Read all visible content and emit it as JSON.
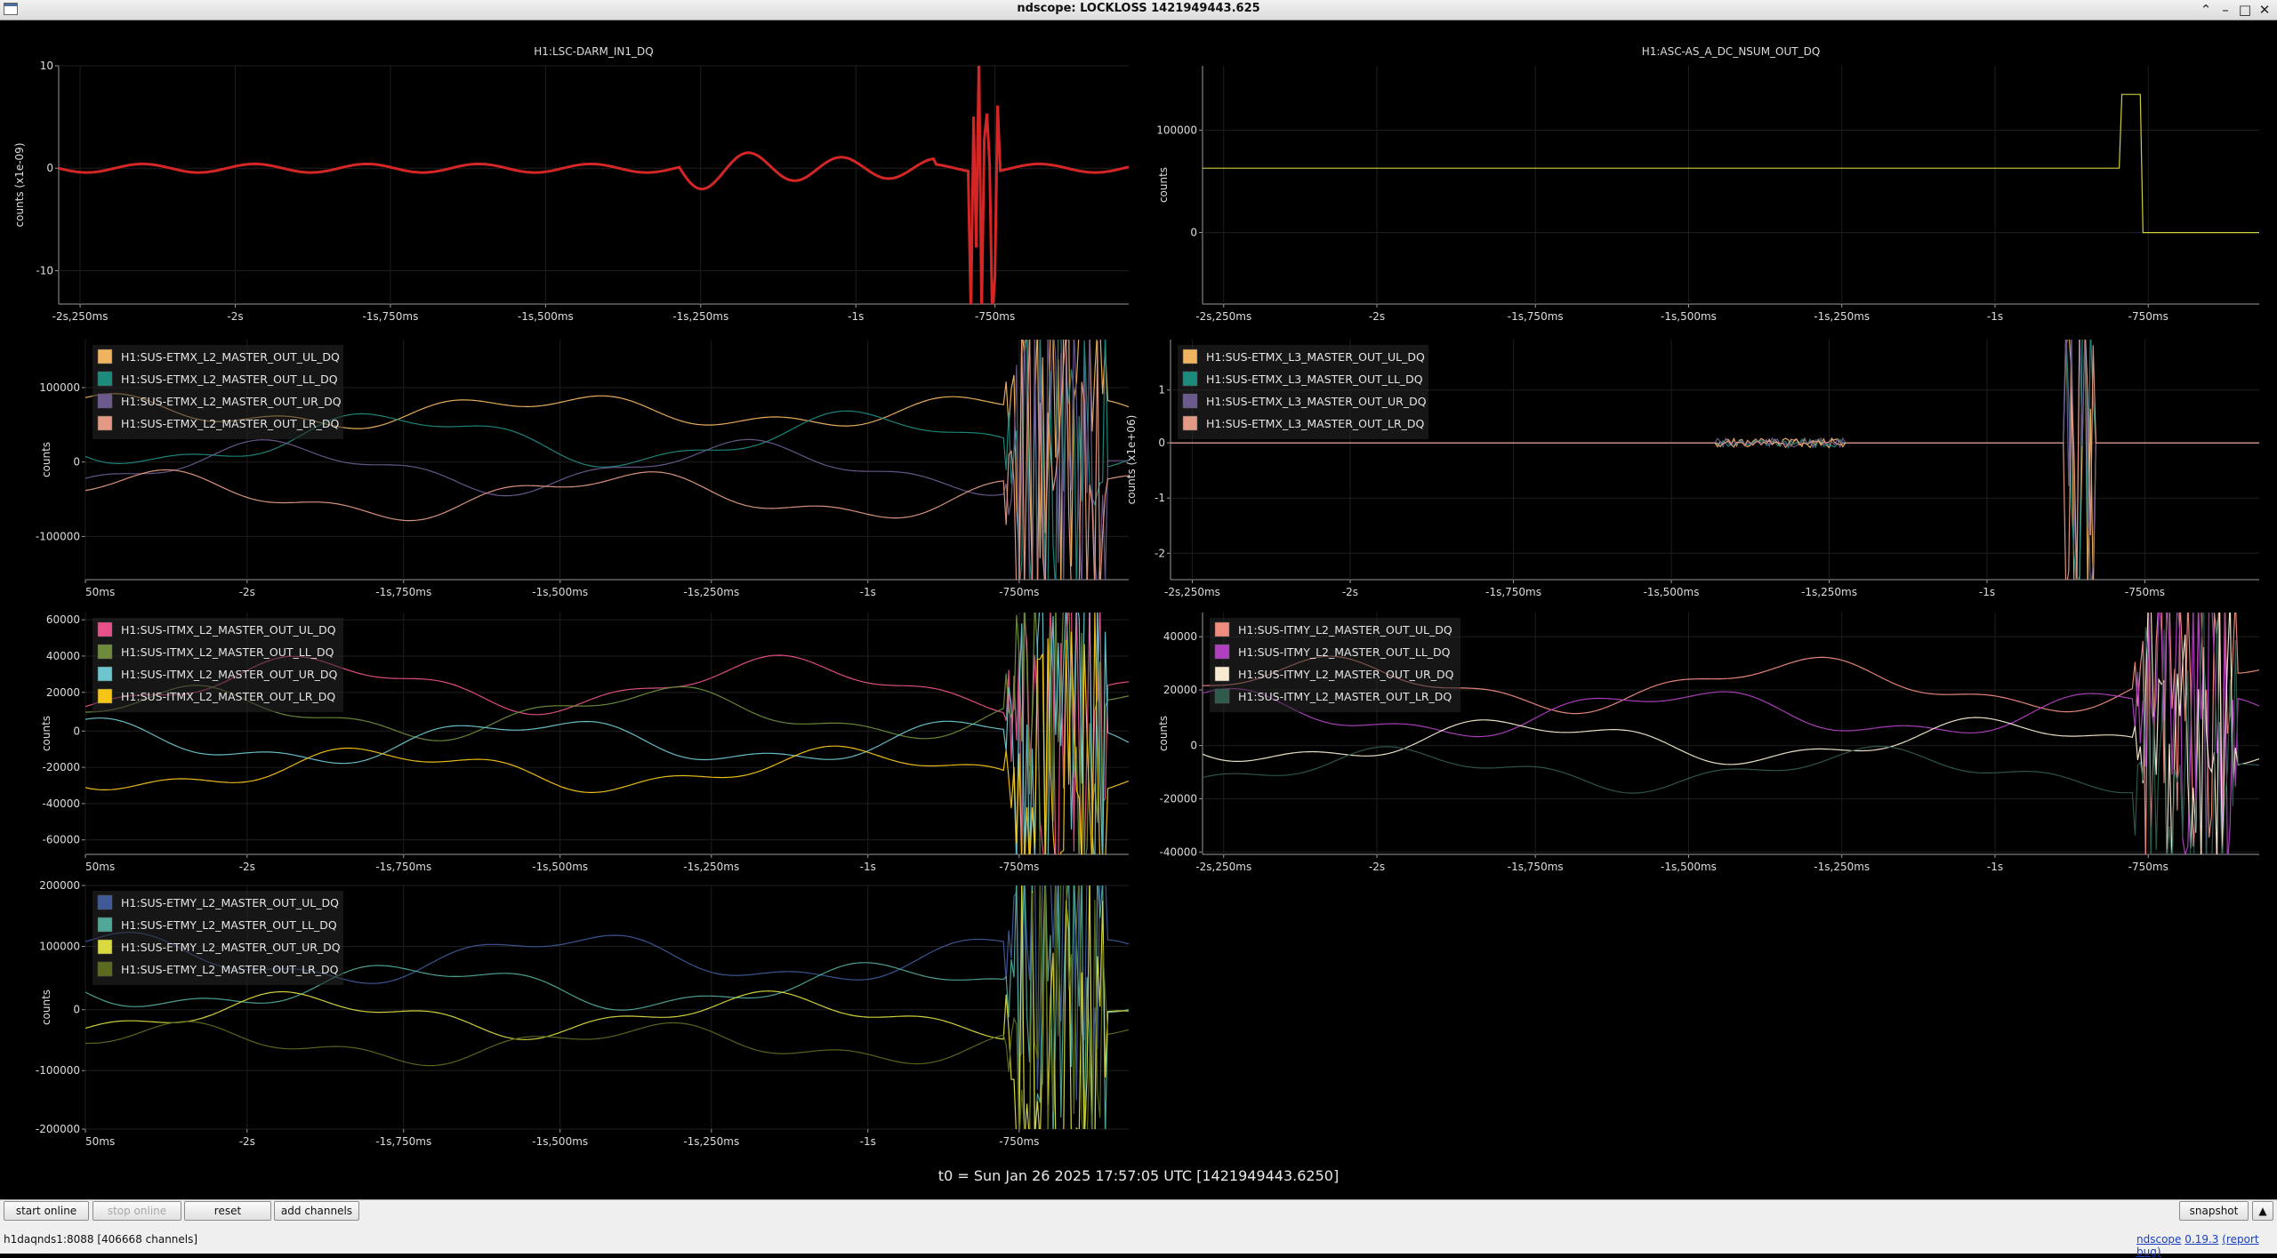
{
  "window": {
    "title": "ndscope: LOCKLOSS 1421949443.625"
  },
  "plots": [
    {
      "id": "p1",
      "title": "H1:LSC-DARM_IN1_DQ",
      "ylabel": "counts (x1e-09)",
      "yticks": [
        "10",
        "0",
        "-10"
      ],
      "xticks": [
        "-2s,250ms",
        "-2s",
        "-1s,750ms",
        "-1s,500ms",
        "-1s,250ms",
        "-1s",
        "-750ms"
      ],
      "legend": []
    },
    {
      "id": "p2",
      "title": "H1:ASC-AS_A_DC_NSUM_OUT_DQ",
      "ylabel": "counts",
      "yticks": [
        "100000",
        "0"
      ],
      "xticks": [
        "-2s,250ms",
        "-2s",
        "-1s,750ms",
        "-1s,500ms",
        "-1s,250ms",
        "-1s",
        "-750ms"
      ],
      "legend": []
    },
    {
      "id": "p3",
      "title": "",
      "ylabel": "counts",
      "yticks": [
        "100000",
        "0",
        "-100000"
      ],
      "xticks": [
        "50ms",
        "-2s",
        "-1s,750ms",
        "-1s,500ms",
        "-1s,250ms",
        "-1s",
        "-750ms"
      ],
      "legend": [
        {
          "name": "H1:SUS-ETMX_L2_MASTER_OUT_UL_DQ",
          "color": "#f0b460"
        },
        {
          "name": "H1:SUS-ETMX_L2_MASTER_OUT_LL_DQ",
          "color": "#1d8a7e"
        },
        {
          "name": "H1:SUS-ETMX_L2_MASTER_OUT_UR_DQ",
          "color": "#6c5a8e"
        },
        {
          "name": "H1:SUS-ETMX_L2_MASTER_OUT_LR_DQ",
          "color": "#e39a84"
        }
      ]
    },
    {
      "id": "p4",
      "title": "",
      "ylabel": "counts (x1e+06)",
      "yticks": [
        "1",
        "0",
        "-1",
        "-2"
      ],
      "xticks": [
        "-2s,250ms",
        "-2s",
        "-1s,750ms",
        "-1s,500ms",
        "-1s,250ms",
        "-1s",
        "-750ms"
      ],
      "legend": [
        {
          "name": "H1:SUS-ETMX_L3_MASTER_OUT_UL_DQ",
          "color": "#f0b460"
        },
        {
          "name": "H1:SUS-ETMX_L3_MASTER_OUT_LL_DQ",
          "color": "#1d8a7e"
        },
        {
          "name": "H1:SUS-ETMX_L3_MASTER_OUT_UR_DQ",
          "color": "#6c5a8e"
        },
        {
          "name": "H1:SUS-ETMX_L3_MASTER_OUT_LR_DQ",
          "color": "#e39a84"
        }
      ]
    },
    {
      "id": "p5",
      "title": "",
      "ylabel": "counts",
      "yticks": [
        "60000",
        "40000",
        "20000",
        "0",
        "-20000",
        "-40000",
        "-60000"
      ],
      "xticks": [
        "50ms",
        "-2s",
        "-1s,750ms",
        "-1s,500ms",
        "-1s,250ms",
        "-1s",
        "-750ms"
      ],
      "legend": [
        {
          "name": "H1:SUS-ITMX_L2_MASTER_OUT_UL_DQ",
          "color": "#e8508a"
        },
        {
          "name": "H1:SUS-ITMX_L2_MASTER_OUT_LL_DQ",
          "color": "#6e8c3c"
        },
        {
          "name": "H1:SUS-ITMX_L2_MASTER_OUT_UR_DQ",
          "color": "#6cc6d0"
        },
        {
          "name": "H1:SUS-ITMX_L2_MASTER_OUT_LR_DQ",
          "color": "#f5c518"
        }
      ]
    },
    {
      "id": "p6",
      "title": "",
      "ylabel": "counts",
      "yticks": [
        "40000",
        "20000",
        "0",
        "-20000",
        "-40000"
      ],
      "xticks": [
        "-2s,250ms",
        "-2s",
        "-1s,750ms",
        "-1s,500ms",
        "-1s,250ms",
        "-1s",
        "-750ms"
      ],
      "legend": [
        {
          "name": "H1:SUS-ITMY_L2_MASTER_OUT_UL_DQ",
          "color": "#f08b80"
        },
        {
          "name": "H1:SUS-ITMY_L2_MASTER_OUT_LL_DQ",
          "color": "#b040c0"
        },
        {
          "name": "H1:SUS-ITMY_L2_MASTER_OUT_UR_DQ",
          "color": "#f6ead0"
        },
        {
          "name": "H1:SUS-ITMY_L2_MASTER_OUT_LR_DQ",
          "color": "#2f5a4e"
        }
      ]
    },
    {
      "id": "p7",
      "title": "",
      "ylabel": "counts",
      "yticks": [
        "200000",
        "100000",
        "0",
        "-100000",
        "-200000"
      ],
      "xticks": [
        "50ms",
        "-2s",
        "-1s,750ms",
        "-1s,500ms",
        "-1s,250ms",
        "-1s",
        "-750ms"
      ],
      "legend": [
        {
          "name": "H1:SUS-ETMY_L2_MASTER_OUT_UL_DQ",
          "color": "#3e5a99"
        },
        {
          "name": "H1:SUS-ETMY_L2_MASTER_OUT_LL_DQ",
          "color": "#4fa898"
        },
        {
          "name": "H1:SUS-ETMY_L2_MASTER_OUT_UR_DQ",
          "color": "#dada40"
        },
        {
          "name": "H1:SUS-ETMY_L2_MASTER_OUT_LR_DQ",
          "color": "#5a6a1e"
        }
      ]
    }
  ],
  "t0_label": "t0 = Sun Jan 26 2025 17:57:05 UTC [1421949443.6250]",
  "toolbar": {
    "start_online": "start online",
    "stop_online": "stop online",
    "reset": "reset",
    "add_channels": "add channels",
    "snapshot": "snapshot"
  },
  "status": {
    "server": "h1daqnds1:8088  [406668 channels]",
    "version_prefix": "ndscope",
    "version": "0.19.3",
    "report_bug": "(report bug)"
  },
  "colors": {
    "background": "#000000",
    "darm_trace": "#e02828",
    "nsum_trace": "#d8d840"
  }
}
